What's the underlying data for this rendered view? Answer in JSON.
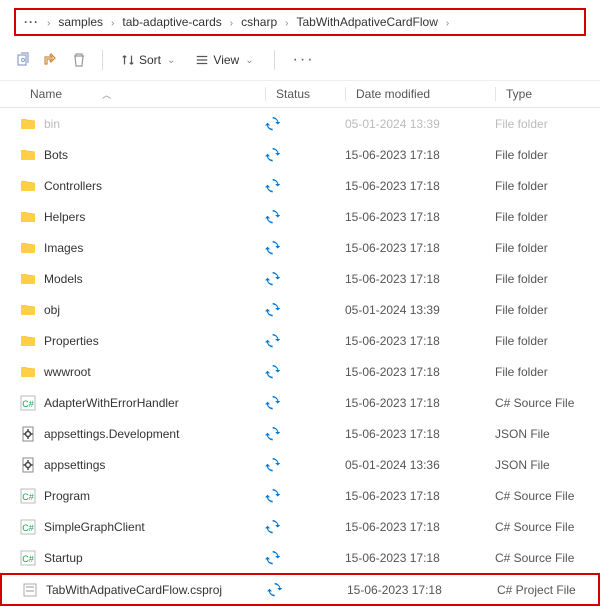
{
  "breadcrumb": {
    "ellipsis": "···",
    "items": [
      "samples",
      "tab-adaptive-cards",
      "csharp",
      "TabWithAdpativeCardFlow"
    ]
  },
  "toolbar": {
    "sort_label": "Sort",
    "view_label": "View"
  },
  "columns": {
    "name": "Name",
    "status": "Status",
    "date": "Date modified",
    "type": "Type"
  },
  "rows": [
    {
      "icon": "folder",
      "name": "bin",
      "sync": true,
      "date": "05-01-2024 13:39",
      "type": "File folder",
      "dim": true
    },
    {
      "icon": "folder",
      "name": "Bots",
      "sync": true,
      "date": "15-06-2023 17:18",
      "type": "File folder"
    },
    {
      "icon": "folder",
      "name": "Controllers",
      "sync": true,
      "date": "15-06-2023 17:18",
      "type": "File folder"
    },
    {
      "icon": "folder",
      "name": "Helpers",
      "sync": true,
      "date": "15-06-2023 17:18",
      "type": "File folder"
    },
    {
      "icon": "folder",
      "name": "Images",
      "sync": true,
      "date": "15-06-2023 17:18",
      "type": "File folder"
    },
    {
      "icon": "folder",
      "name": "Models",
      "sync": true,
      "date": "15-06-2023 17:18",
      "type": "File folder"
    },
    {
      "icon": "folder",
      "name": "obj",
      "sync": true,
      "date": "05-01-2024 13:39",
      "type": "File folder"
    },
    {
      "icon": "folder",
      "name": "Properties",
      "sync": true,
      "date": "15-06-2023 17:18",
      "type": "File folder"
    },
    {
      "icon": "folder",
      "name": "wwwroot",
      "sync": true,
      "date": "15-06-2023 17:18",
      "type": "File folder"
    },
    {
      "icon": "cs",
      "name": "AdapterWithErrorHandler",
      "sync": true,
      "date": "15-06-2023 17:18",
      "type": "C# Source File"
    },
    {
      "icon": "json",
      "name": "appsettings.Development",
      "sync": true,
      "date": "15-06-2023 17:18",
      "type": "JSON File"
    },
    {
      "icon": "json",
      "name": "appsettings",
      "sync": true,
      "date": "05-01-2024 13:36",
      "type": "JSON File"
    },
    {
      "icon": "cs",
      "name": "Program",
      "sync": true,
      "date": "15-06-2023 17:18",
      "type": "C# Source File"
    },
    {
      "icon": "cs",
      "name": "SimpleGraphClient",
      "sync": true,
      "date": "15-06-2023 17:18",
      "type": "C# Source File"
    },
    {
      "icon": "cs",
      "name": "Startup",
      "sync": true,
      "date": "15-06-2023 17:18",
      "type": "C# Source File"
    },
    {
      "icon": "csproj",
      "name": "TabWithAdpativeCardFlow.csproj",
      "sync": true,
      "date": "15-06-2023 17:18",
      "type": "C# Project File",
      "highlight": true
    }
  ]
}
